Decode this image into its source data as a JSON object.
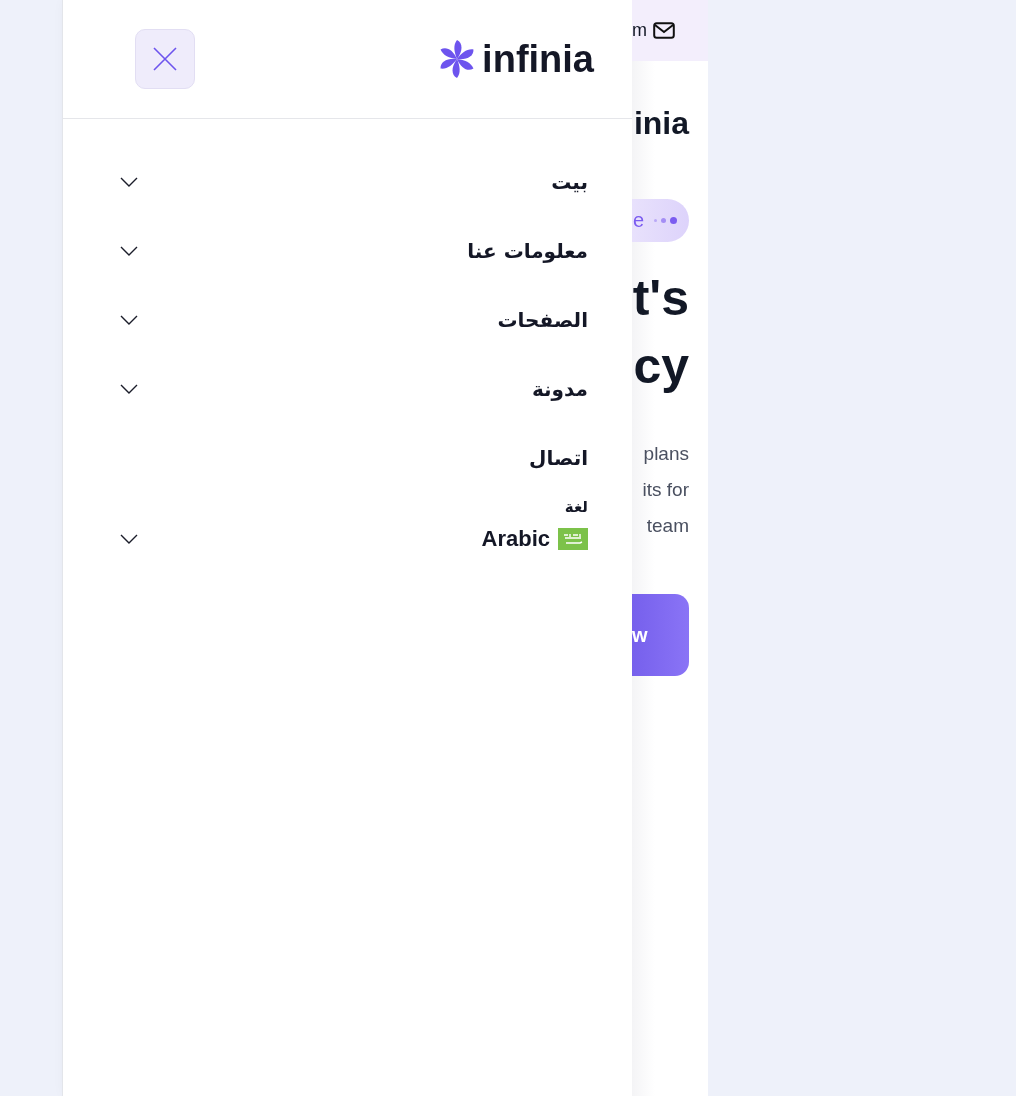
{
  "background_page": {
    "top_bar_text": "m",
    "brand_heading": "inia",
    "badge": {
      "label": "e"
    },
    "headline": [
      "t's",
      "cy"
    ],
    "paragraph": [
      "plans",
      "its for",
      "team"
    ],
    "cta_button": "w"
  },
  "drawer": {
    "logo_text": "infinia",
    "menu": [
      {
        "label": "بيت",
        "has_submenu": true
      },
      {
        "label": "معلومات عنا",
        "has_submenu": true
      },
      {
        "label": "الصفحات",
        "has_submenu": true
      },
      {
        "label": "مدونة",
        "has_submenu": true
      },
      {
        "label": "اتصال",
        "has_submenu": false
      }
    ],
    "language": {
      "label": "لغة",
      "value": "Arabic"
    }
  }
}
